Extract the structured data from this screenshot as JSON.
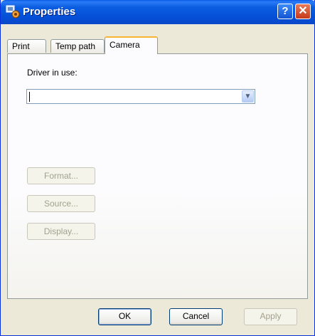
{
  "window": {
    "title": "Properties"
  },
  "titlebar": {
    "help_label": "?",
    "close_label": "✕"
  },
  "tabs": [
    {
      "label": "Print"
    },
    {
      "label": "Temp path"
    },
    {
      "label": "Camera",
      "active": true
    }
  ],
  "camera": {
    "driver_label": "Driver in use:",
    "driver_value": "",
    "format_label": "Format...",
    "source_label": "Source...",
    "display_label": "Display..."
  },
  "footer": {
    "ok_label": "OK",
    "cancel_label": "Cancel",
    "apply_label": "Apply"
  },
  "colors": {
    "titlebar": "#0450D8",
    "face": "#ECE9D8",
    "active_tab_accent": "#F8B433"
  }
}
